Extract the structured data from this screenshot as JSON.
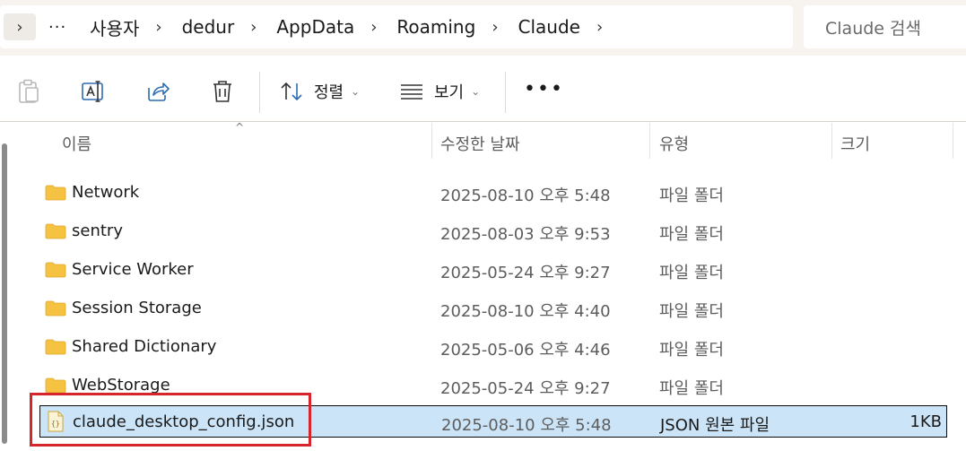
{
  "address": {
    "expand_glyph": "›",
    "more_glyph": "···",
    "separator": "›",
    "crumbs": [
      "사용자",
      "dedur",
      "AppData",
      "Roaming",
      "Claude"
    ],
    "search_placeholder": "Claude 검색"
  },
  "toolbar": {
    "sort_label": "정렬",
    "view_label": "보기",
    "more_label": "•••",
    "chevron": "⌄"
  },
  "columns": {
    "name": "이름",
    "modified": "수정한 날짜",
    "type": "유형",
    "size": "크기",
    "sort_arrow": "^"
  },
  "rows": [
    {
      "name": "Network",
      "date": "2025-08-10 오후 5:48",
      "type": "파일 폴더",
      "size": "",
      "kind": "folder"
    },
    {
      "name": "sentry",
      "date": "2025-08-03 오후 9:53",
      "type": "파일 폴더",
      "size": "",
      "kind": "folder"
    },
    {
      "name": "Service Worker",
      "date": "2025-05-24 오후 9:27",
      "type": "파일 폴더",
      "size": "",
      "kind": "folder"
    },
    {
      "name": "Session Storage",
      "date": "2025-08-10 오후 4:40",
      "type": "파일 폴더",
      "size": "",
      "kind": "folder"
    },
    {
      "name": "Shared Dictionary",
      "date": "2025-05-06 오후 4:46",
      "type": "파일 폴더",
      "size": "",
      "kind": "folder"
    },
    {
      "name": "WebStorage",
      "date": "2025-05-24 오후 9:27",
      "type": "파일 폴더",
      "size": "",
      "kind": "folder"
    },
    {
      "name": "claude_desktop_config.json",
      "date": "2025-08-10 오후 5:48",
      "type": "JSON 원본 파일",
      "size": "1KB",
      "kind": "json"
    }
  ],
  "colors": {
    "folder": "#f5c242",
    "selection": "#cce4f7",
    "highlight": "#d7262b"
  }
}
